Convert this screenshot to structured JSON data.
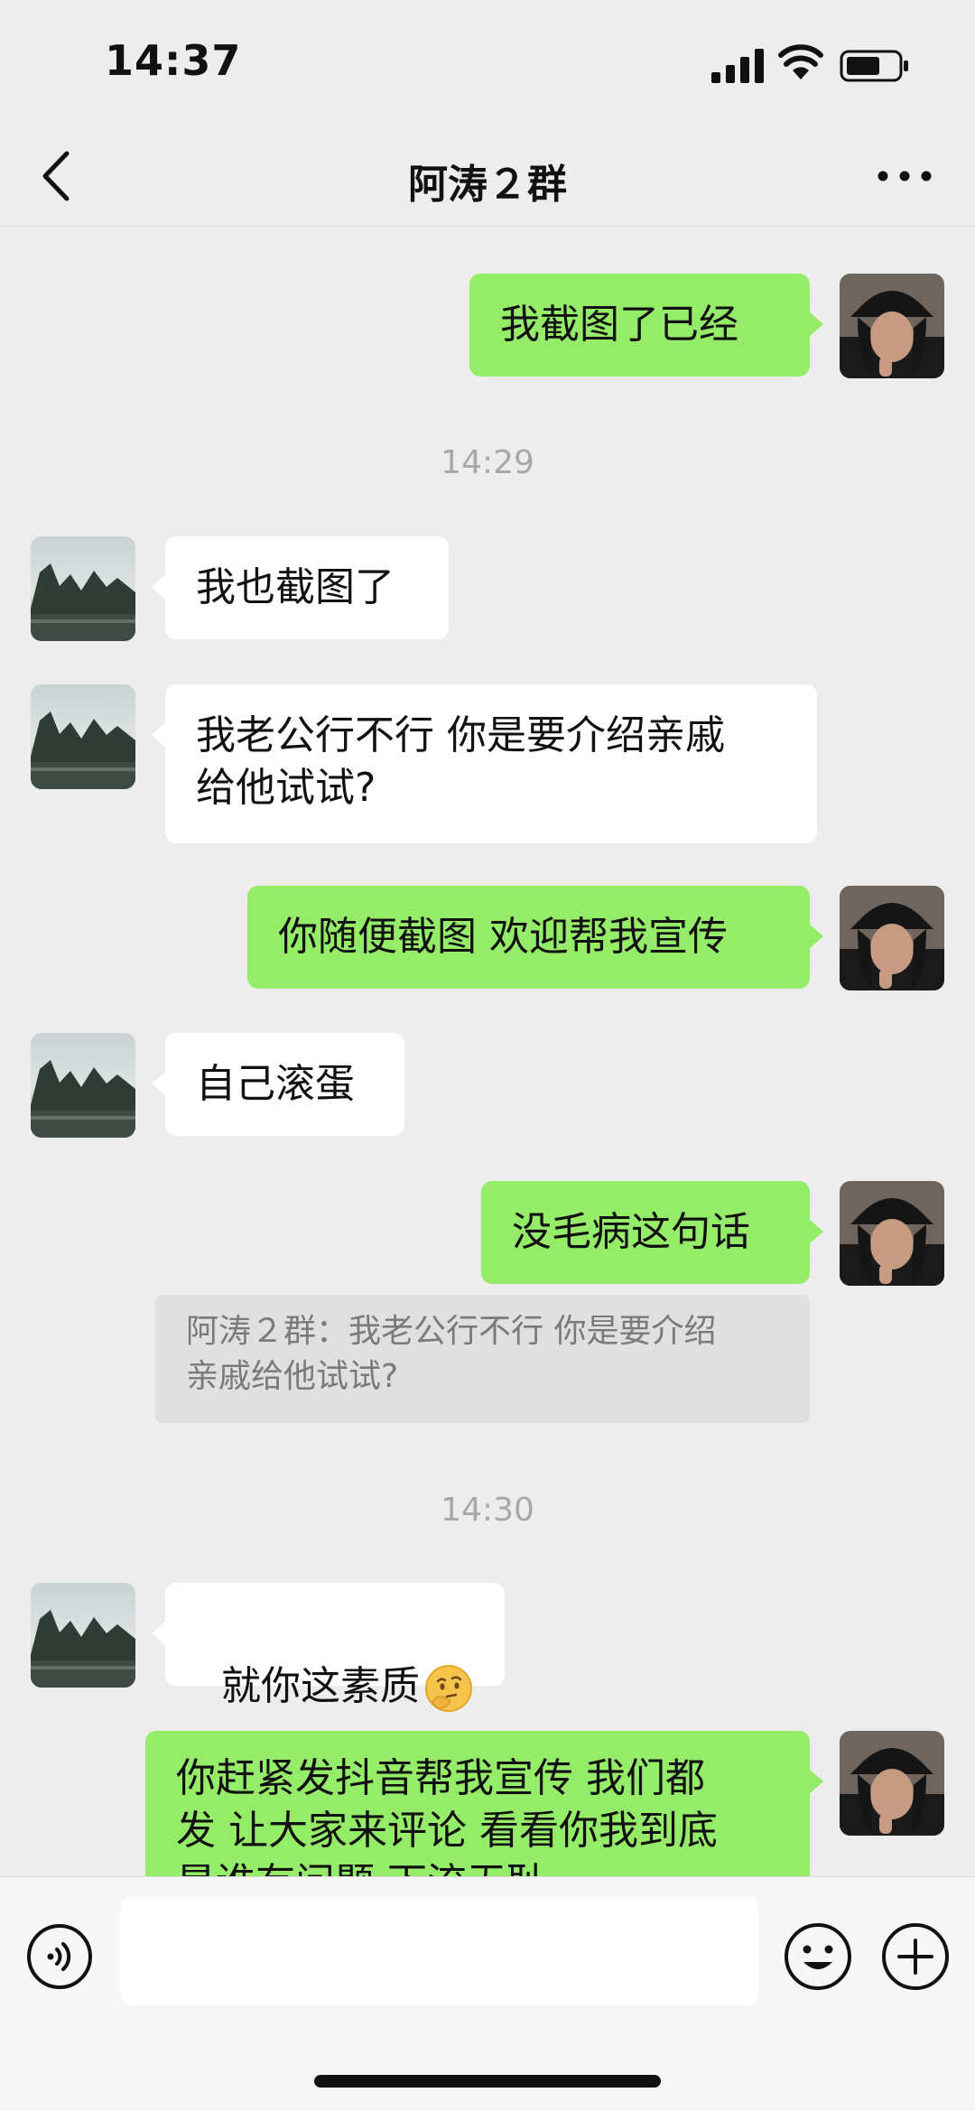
{
  "status_bar": {
    "time": "14:37"
  },
  "header": {
    "title": "阿涛２群"
  },
  "messages": [
    {
      "side": "me",
      "text": "我截图了已经"
    },
    {
      "side": "other",
      "text": "我也截图了"
    },
    {
      "side": "other",
      "text": "我老公行不行 你是要介绍亲戚\n给他试试?"
    },
    {
      "side": "me",
      "text": "你随便截图 欢迎帮我宣传"
    },
    {
      "side": "other",
      "text": "自己滚蛋"
    },
    {
      "side": "me",
      "text": "没毛病这句话"
    },
    {
      "side": "other",
      "text": "就你这素质",
      "emoji": "thinking-face"
    },
    {
      "side": "me",
      "text": "你赶紧发抖音帮我宣传 我们都\n发 让大家来评论 看看你我到底\n是谁有问题 下流无耻"
    }
  ],
  "timestamps": [
    "14:29",
    "14:30"
  ],
  "quote": {
    "text": "阿涛２群：我老公行不行 你是要介绍\n亲戚给他试试?"
  },
  "input": {
    "placeholder": ""
  },
  "colors": {
    "my_bubble": "#95ec69",
    "other_bubble": "#ffffff",
    "background": "#ededed"
  },
  "icons": [
    "back-icon",
    "more-icon",
    "voice-icon",
    "emoji-icon",
    "plus-icon"
  ]
}
